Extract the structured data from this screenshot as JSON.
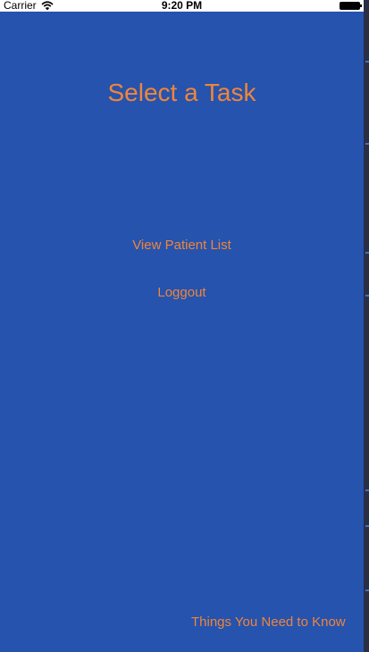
{
  "status_bar": {
    "carrier": "Carrier",
    "time": "9:20 PM",
    "wifi_icon": "wifi-icon",
    "battery_icon": "battery-icon"
  },
  "screen": {
    "title": "Select a Task",
    "buttons": [
      {
        "label": "View Patient List"
      },
      {
        "label": "Loggout"
      }
    ],
    "footer_link": "Things You Need to Know"
  },
  "colors": {
    "background": "#2553ae",
    "accent": "#f0853a",
    "status_bar": "#ffffff"
  }
}
